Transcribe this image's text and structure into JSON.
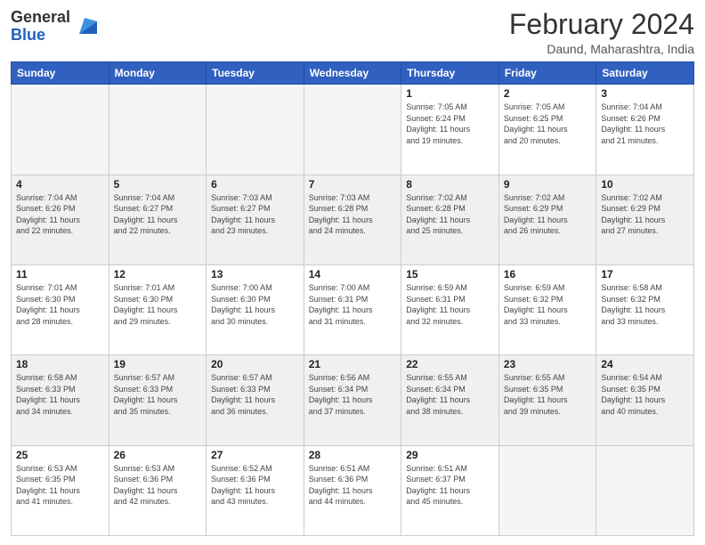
{
  "header": {
    "logo_line1": "General",
    "logo_line2": "Blue",
    "title": "February 2024",
    "subtitle": "Daund, Maharashtra, India"
  },
  "days_of_week": [
    "Sunday",
    "Monday",
    "Tuesday",
    "Wednesday",
    "Thursday",
    "Friday",
    "Saturday"
  ],
  "weeks": [
    {
      "shade": "white",
      "days": [
        {
          "num": "",
          "info": ""
        },
        {
          "num": "",
          "info": ""
        },
        {
          "num": "",
          "info": ""
        },
        {
          "num": "",
          "info": ""
        },
        {
          "num": "1",
          "info": "Sunrise: 7:05 AM\nSunset: 6:24 PM\nDaylight: 11 hours\nand 19 minutes."
        },
        {
          "num": "2",
          "info": "Sunrise: 7:05 AM\nSunset: 6:25 PM\nDaylight: 11 hours\nand 20 minutes."
        },
        {
          "num": "3",
          "info": "Sunrise: 7:04 AM\nSunset: 6:26 PM\nDaylight: 11 hours\nand 21 minutes."
        }
      ]
    },
    {
      "shade": "shaded",
      "days": [
        {
          "num": "4",
          "info": "Sunrise: 7:04 AM\nSunset: 6:26 PM\nDaylight: 11 hours\nand 22 minutes."
        },
        {
          "num": "5",
          "info": "Sunrise: 7:04 AM\nSunset: 6:27 PM\nDaylight: 11 hours\nand 22 minutes."
        },
        {
          "num": "6",
          "info": "Sunrise: 7:03 AM\nSunset: 6:27 PM\nDaylight: 11 hours\nand 23 minutes."
        },
        {
          "num": "7",
          "info": "Sunrise: 7:03 AM\nSunset: 6:28 PM\nDaylight: 11 hours\nand 24 minutes."
        },
        {
          "num": "8",
          "info": "Sunrise: 7:02 AM\nSunset: 6:28 PM\nDaylight: 11 hours\nand 25 minutes."
        },
        {
          "num": "9",
          "info": "Sunrise: 7:02 AM\nSunset: 6:29 PM\nDaylight: 11 hours\nand 26 minutes."
        },
        {
          "num": "10",
          "info": "Sunrise: 7:02 AM\nSunset: 6:29 PM\nDaylight: 11 hours\nand 27 minutes."
        }
      ]
    },
    {
      "shade": "white",
      "days": [
        {
          "num": "11",
          "info": "Sunrise: 7:01 AM\nSunset: 6:30 PM\nDaylight: 11 hours\nand 28 minutes."
        },
        {
          "num": "12",
          "info": "Sunrise: 7:01 AM\nSunset: 6:30 PM\nDaylight: 11 hours\nand 29 minutes."
        },
        {
          "num": "13",
          "info": "Sunrise: 7:00 AM\nSunset: 6:30 PM\nDaylight: 11 hours\nand 30 minutes."
        },
        {
          "num": "14",
          "info": "Sunrise: 7:00 AM\nSunset: 6:31 PM\nDaylight: 11 hours\nand 31 minutes."
        },
        {
          "num": "15",
          "info": "Sunrise: 6:59 AM\nSunset: 6:31 PM\nDaylight: 11 hours\nand 32 minutes."
        },
        {
          "num": "16",
          "info": "Sunrise: 6:59 AM\nSunset: 6:32 PM\nDaylight: 11 hours\nand 33 minutes."
        },
        {
          "num": "17",
          "info": "Sunrise: 6:58 AM\nSunset: 6:32 PM\nDaylight: 11 hours\nand 33 minutes."
        }
      ]
    },
    {
      "shade": "shaded",
      "days": [
        {
          "num": "18",
          "info": "Sunrise: 6:58 AM\nSunset: 6:33 PM\nDaylight: 11 hours\nand 34 minutes."
        },
        {
          "num": "19",
          "info": "Sunrise: 6:57 AM\nSunset: 6:33 PM\nDaylight: 11 hours\nand 35 minutes."
        },
        {
          "num": "20",
          "info": "Sunrise: 6:57 AM\nSunset: 6:33 PM\nDaylight: 11 hours\nand 36 minutes."
        },
        {
          "num": "21",
          "info": "Sunrise: 6:56 AM\nSunset: 6:34 PM\nDaylight: 11 hours\nand 37 minutes."
        },
        {
          "num": "22",
          "info": "Sunrise: 6:55 AM\nSunset: 6:34 PM\nDaylight: 11 hours\nand 38 minutes."
        },
        {
          "num": "23",
          "info": "Sunrise: 6:55 AM\nSunset: 6:35 PM\nDaylight: 11 hours\nand 39 minutes."
        },
        {
          "num": "24",
          "info": "Sunrise: 6:54 AM\nSunset: 6:35 PM\nDaylight: 11 hours\nand 40 minutes."
        }
      ]
    },
    {
      "shade": "white",
      "days": [
        {
          "num": "25",
          "info": "Sunrise: 6:53 AM\nSunset: 6:35 PM\nDaylight: 11 hours\nand 41 minutes."
        },
        {
          "num": "26",
          "info": "Sunrise: 6:53 AM\nSunset: 6:36 PM\nDaylight: 11 hours\nand 42 minutes."
        },
        {
          "num": "27",
          "info": "Sunrise: 6:52 AM\nSunset: 6:36 PM\nDaylight: 11 hours\nand 43 minutes."
        },
        {
          "num": "28",
          "info": "Sunrise: 6:51 AM\nSunset: 6:36 PM\nDaylight: 11 hours\nand 44 minutes."
        },
        {
          "num": "29",
          "info": "Sunrise: 6:51 AM\nSunset: 6:37 PM\nDaylight: 11 hours\nand 45 minutes."
        },
        {
          "num": "",
          "info": ""
        },
        {
          "num": "",
          "info": ""
        }
      ]
    }
  ]
}
